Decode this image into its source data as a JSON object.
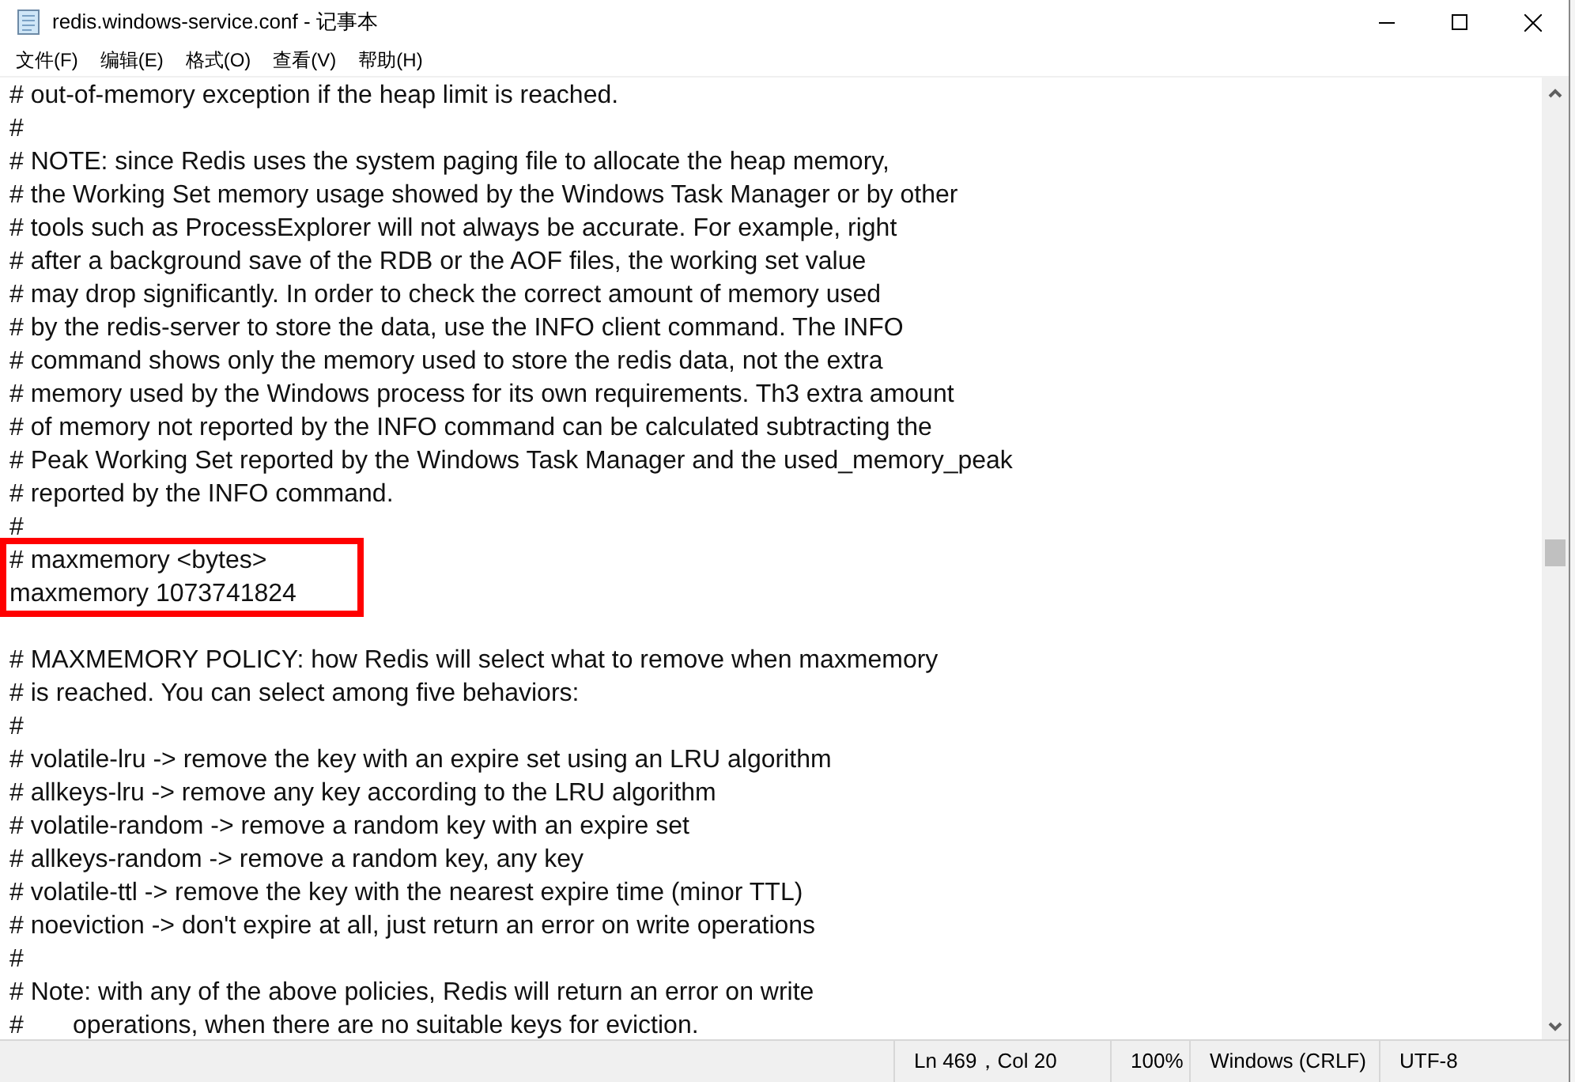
{
  "window": {
    "title": "redis.windows-service.conf - 记事本"
  },
  "menu": [
    "文件(F)",
    "编辑(E)",
    "格式(O)",
    "查看(V)",
    "帮助(H)"
  ],
  "lines": [
    {
      "kind": "line",
      "text": "# out-of-memory exception if the heap limit is reached."
    },
    {
      "kind": "line",
      "text": "#"
    },
    {
      "kind": "line",
      "text": "# NOTE: since Redis uses the system paging file to allocate the heap memory,"
    },
    {
      "kind": "line",
      "text": "# the Working Set memory usage showed by the Windows Task Manager or by other"
    },
    {
      "kind": "line",
      "text": "# tools such as ProcessExplorer will not always be accurate. For example, right"
    },
    {
      "kind": "line",
      "text": "# after a background save of the RDB or the AOF files, the working set value"
    },
    {
      "kind": "line",
      "text": "# may drop significantly. In order to check the correct amount of memory used"
    },
    {
      "kind": "line",
      "text": "# by the redis-server to store the data, use the INFO client command. The INFO"
    },
    {
      "kind": "line",
      "text": "# command shows only the memory used to store the redis data, not the extra"
    },
    {
      "kind": "line",
      "text": "# memory used by the Windows process for its own requirements. Th3 extra amount"
    },
    {
      "kind": "line",
      "text": "# of memory not reported by the INFO command can be calculated subtracting the"
    },
    {
      "kind": "line",
      "text": "# Peak Working Set reported by the Windows Task Manager and the used_memory_peak"
    },
    {
      "kind": "line",
      "text": "# reported by the INFO command."
    },
    {
      "kind": "line",
      "text": "#"
    },
    {
      "kind": "highlight",
      "lines": [
        {
          "kind": "line",
          "text": "# maxmemory <bytes>"
        },
        {
          "kind": "line",
          "text": "maxmemory 1073741824"
        }
      ]
    },
    {
      "kind": "blank"
    },
    {
      "kind": "line",
      "text": "# MAXMEMORY POLICY: how Redis will select what to remove when maxmemory"
    },
    {
      "kind": "line",
      "text": "# is reached. You can select among five behaviors:"
    },
    {
      "kind": "line",
      "text": "#"
    },
    {
      "kind": "line",
      "text": "# volatile-lru -> remove the key with an expire set using an LRU algorithm"
    },
    {
      "kind": "line",
      "text": "# allkeys-lru -> remove any key according to the LRU algorithm"
    },
    {
      "kind": "line",
      "text": "# volatile-random -> remove a random key with an expire set"
    },
    {
      "kind": "line",
      "text": "# allkeys-random -> remove a random key, any key"
    },
    {
      "kind": "line",
      "text": "# volatile-ttl -> remove the key with the nearest expire time (minor TTL)"
    },
    {
      "kind": "line",
      "text": "# noeviction -> don't expire at all, just return an error on write operations"
    },
    {
      "kind": "line",
      "text": "#"
    },
    {
      "kind": "line",
      "text": "# Note: with any of the above policies, Redis will return an error on write"
    },
    {
      "kind": "line",
      "text": "#       operations, when there are no suitable keys for eviction."
    }
  ],
  "status_bar": [
    "Ln 469，Col 20",
    "100%",
    "Windows (CRLF)",
    "UTF-8"
  ]
}
